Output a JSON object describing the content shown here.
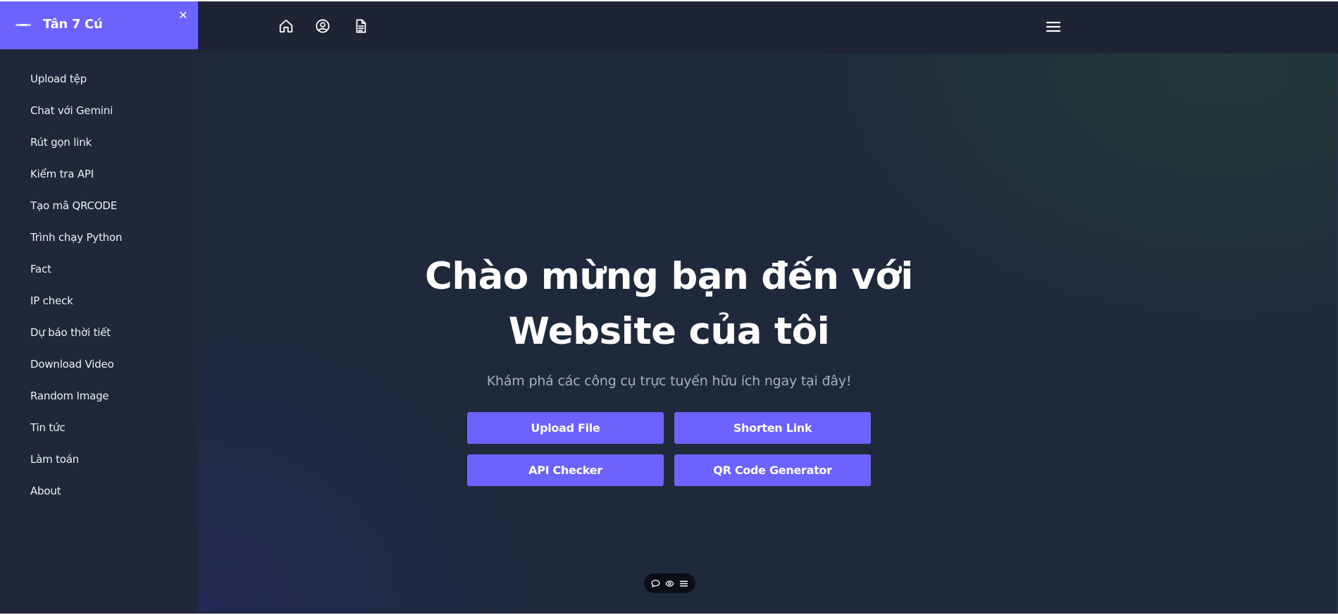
{
  "sidebar": {
    "brand": "Tân 7 Cú",
    "close_glyph": "✕",
    "items": [
      {
        "label": "Upload tệp"
      },
      {
        "label": "Chat với Gemini"
      },
      {
        "label": "Rút gọn link"
      },
      {
        "label": "Kiểm tra API"
      },
      {
        "label": "Tạo mã QRCODE"
      },
      {
        "label": "Trình chạy Python"
      },
      {
        "label": "Fact"
      },
      {
        "label": "IP check"
      },
      {
        "label": "Dự báo thời tiết"
      },
      {
        "label": "Download Video"
      },
      {
        "label": "Random Image"
      },
      {
        "label": "Tin tức"
      },
      {
        "label": "Làm toán"
      },
      {
        "label": "About"
      }
    ]
  },
  "topbar": {
    "icons": [
      "home-icon",
      "user-circle-icon",
      "document-icon",
      "hamburger-menu-icon"
    ]
  },
  "hero": {
    "title_line1": "Chào mừng bạn đến với",
    "title_line2": "Website của tôi",
    "subtitle": "Khám phá các công cụ trực tuyến hữu ích ngay tại đây!",
    "buttons": [
      {
        "label": "Upload File"
      },
      {
        "label": "Shorten Link"
      },
      {
        "label": "API Checker"
      },
      {
        "label": "QR Code Generator"
      }
    ]
  },
  "floating_toolbar": {
    "icons": [
      "chat-bubble-icon",
      "eye-icon",
      "list-icon"
    ]
  },
  "colors": {
    "accent": "#6c63ff",
    "sidebar_bg": "#1f2738",
    "topbar_bg": "#1e2433",
    "main_bg": "#1e293b",
    "text": "#ffffff",
    "subtext": "#a7b0c3"
  }
}
